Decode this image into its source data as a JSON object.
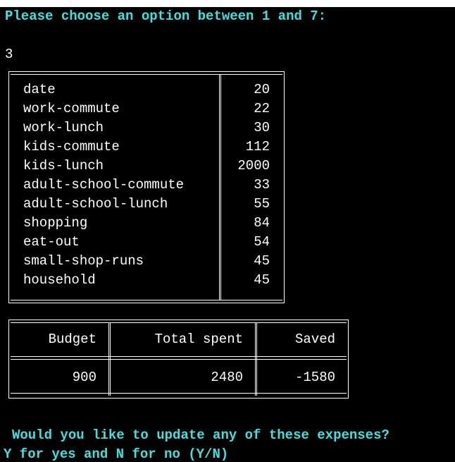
{
  "prompt": "Please choose an option between 1 and 7:",
  "user_input": "3",
  "expenses": [
    {
      "category": "date",
      "amount": "20"
    },
    {
      "category": "work-commute",
      "amount": "22"
    },
    {
      "category": "work-lunch",
      "amount": "30"
    },
    {
      "category": "kids-commute",
      "amount": "112"
    },
    {
      "category": "kids-lunch",
      "amount": "2000"
    },
    {
      "category": "adult-school-commute",
      "amount": "33"
    },
    {
      "category": "adult-school-lunch",
      "amount": "55"
    },
    {
      "category": "shopping",
      "amount": "84"
    },
    {
      "category": "eat-out",
      "amount": "54"
    },
    {
      "category": "small-shop-runs",
      "amount": "45"
    },
    {
      "category": "household",
      "amount": "45"
    }
  ],
  "summary": {
    "headers": {
      "budget": "Budget",
      "total_spent": "Total spent",
      "saved": "Saved"
    },
    "values": {
      "budget": "900",
      "total_spent": "2480",
      "saved": "-1580"
    }
  },
  "question": "Would you like to update any of these expenses?",
  "yes_no_prompt": "Y for yes and N for no (Y/N)",
  "colors": {
    "background": "#000000",
    "text": "#ffffff",
    "prompt_cyan": "#3fe0e0"
  }
}
